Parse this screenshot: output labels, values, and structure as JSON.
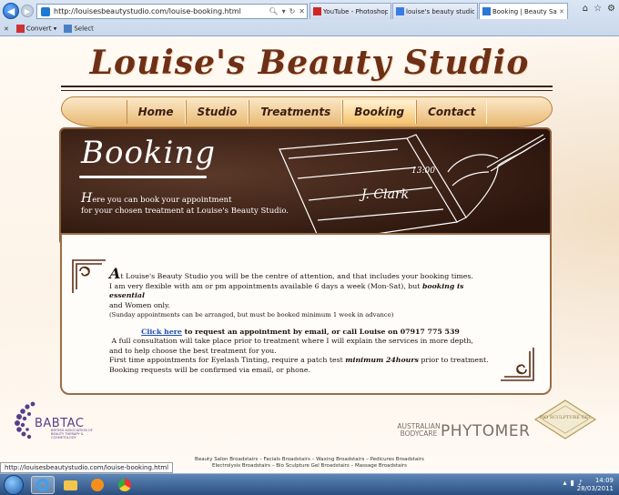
{
  "browser": {
    "url": "http://louisesbeautystudio.com/louise-booking.html",
    "tabs": [
      {
        "label": "YouTube - Photoshop: Un...",
        "active": false,
        "color": "#d02525"
      },
      {
        "label": "louise's beauty studio - Go...",
        "active": false,
        "color": "#3b7be8"
      },
      {
        "label": "Booking | Beauty Salon ...",
        "active": true,
        "color": "#2a78d1"
      }
    ],
    "commands": {
      "convert": "Convert",
      "select": "Select"
    },
    "status_url": "http://louisesbeautystudio.com/louise-booking.html"
  },
  "site": {
    "title": "Louise's Beauty Studio",
    "nav": [
      {
        "label": "Home",
        "active": false
      },
      {
        "label": "Studio",
        "active": false
      },
      {
        "label": "Treatments",
        "active": false
      },
      {
        "label": "Booking",
        "active": true
      },
      {
        "label": "Contact",
        "active": false
      }
    ]
  },
  "hero": {
    "title": "Booking",
    "intro_cap": "H",
    "intro_rest": "ere you can book your appointment",
    "intro_line2": "for your chosen treatment at Louise's Beauty Studio.",
    "signature": "J. Clark",
    "sig_time": "13:00"
  },
  "content": {
    "drop_letter": "A",
    "p1a": "t Louise's Beauty Studio you will be the centre of attention, and that includes your booking times.",
    "p1b": "I am very flexible with am or pm appointments available 6 days a week (Mon-Sat), but",
    "p1b_bold": "booking is essential",
    "p1c": "and Women only.",
    "p1_small": "(Sunday appointments can be arranged, but must be booked minimum 1 week in advance)",
    "cta_link": "Click here",
    "cta_rest": "to request an appointment by email, or call Louise on 07917 775 539",
    "p2a": "A full consultation will take place prior to treatment where I will explain the services in more depth,",
    "p2b": "and to help choose the best treatment for you.",
    "p3a": "First time appointments for Eyelash Tinting, require a patch test",
    "p3a_bold": "minimum 24hours",
    "p3a_end": "prior to treatment.",
    "p3b": "Booking requests will be confirmed via email, or phone."
  },
  "logos": {
    "babtac": "BABTAC",
    "babtac_sub": "BRITISH ASSOCIATION OF BEAUTY THERAPY & COSMETOLOGY",
    "australian_bodycare": "AUSTRALIAN BODYCARE",
    "phytomer": "PHYTOMER",
    "bio_sculpture": "BIO SCULPTURE GEL"
  },
  "footer": {
    "line1": "Beauty Salon Broadstairs – Facials Broadstairs – Waxing Broadstairs – Pedicures Broadstairs",
    "line2": "Electrolysis Broadstairs – Bio Sculpture Gel Broadstairs – Massage Broadstairs"
  },
  "taskbar": {
    "time": "14:09",
    "date": "28/03/2011"
  }
}
